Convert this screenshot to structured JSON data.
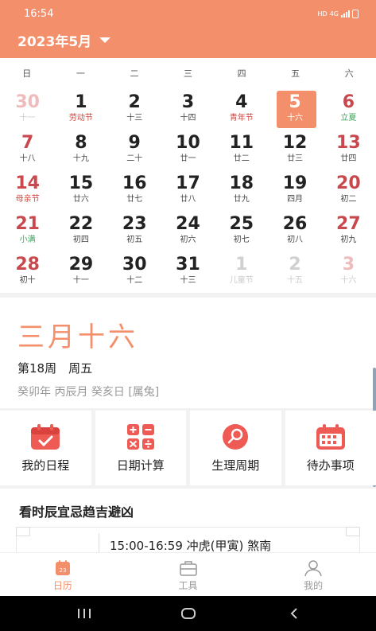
{
  "status": {
    "time": "16:54",
    "network": "HD",
    "signal": "4G"
  },
  "header": {
    "month_title": "2023年5月"
  },
  "weekdays": [
    "日",
    "一",
    "二",
    "三",
    "四",
    "五",
    "六"
  ],
  "days": [
    {
      "num": "30",
      "sub": "十一",
      "other": true,
      "red": true
    },
    {
      "num": "1",
      "sub": "劳动节",
      "hl": "red"
    },
    {
      "num": "2",
      "sub": "十三"
    },
    {
      "num": "3",
      "sub": "十四"
    },
    {
      "num": "4",
      "sub": "青年节",
      "hl": "red"
    },
    {
      "num": "5",
      "sub": "十六",
      "selected": true
    },
    {
      "num": "6",
      "sub": "立夏",
      "red": true,
      "hl": "green"
    },
    {
      "num": "7",
      "sub": "十八",
      "red": true
    },
    {
      "num": "8",
      "sub": "十九"
    },
    {
      "num": "9",
      "sub": "二十"
    },
    {
      "num": "10",
      "sub": "廿一"
    },
    {
      "num": "11",
      "sub": "廿二"
    },
    {
      "num": "12",
      "sub": "廿三"
    },
    {
      "num": "13",
      "sub": "廿四",
      "red": true
    },
    {
      "num": "14",
      "sub": "母亲节",
      "red": true,
      "hl": "red"
    },
    {
      "num": "15",
      "sub": "廿六"
    },
    {
      "num": "16",
      "sub": "廿七"
    },
    {
      "num": "17",
      "sub": "廿八"
    },
    {
      "num": "18",
      "sub": "廿九"
    },
    {
      "num": "19",
      "sub": "四月"
    },
    {
      "num": "20",
      "sub": "初二",
      "red": true
    },
    {
      "num": "21",
      "sub": "小满",
      "red": true,
      "hl": "green"
    },
    {
      "num": "22",
      "sub": "初四"
    },
    {
      "num": "23",
      "sub": "初五"
    },
    {
      "num": "24",
      "sub": "初六"
    },
    {
      "num": "25",
      "sub": "初七"
    },
    {
      "num": "26",
      "sub": "初八"
    },
    {
      "num": "27",
      "sub": "初九",
      "red": true
    },
    {
      "num": "28",
      "sub": "初十",
      "red": true
    },
    {
      "num": "29",
      "sub": "十一"
    },
    {
      "num": "30",
      "sub": "十二"
    },
    {
      "num": "31",
      "sub": "十三"
    },
    {
      "num": "1",
      "sub": "儿童节",
      "other": true
    },
    {
      "num": "2",
      "sub": "十五",
      "other": true
    },
    {
      "num": "3",
      "sub": "十六",
      "other": true,
      "red": true
    }
  ],
  "detail": {
    "lunar_date": "三月十六",
    "week_line": "第18周　周五",
    "ganzhi": "癸卯年 丙辰月 癸亥日 [属兔]"
  },
  "tools": [
    {
      "label": "我的日程",
      "icon": "calendar-check-icon"
    },
    {
      "label": "日期计算",
      "icon": "calculator-icon"
    },
    {
      "label": "生理周期",
      "icon": "cycle-search-icon"
    },
    {
      "label": "待办事项",
      "icon": "calendar-grid-icon"
    }
  ],
  "almanac": {
    "title": "看时辰宜忌趋吉避凶",
    "first_slot": "15:00-16:59  冲虎(甲寅) 煞南"
  },
  "tabs": [
    {
      "label": "日历",
      "icon": "calendar-tab-icon",
      "active": true,
      "badge": "23"
    },
    {
      "label": "工具",
      "icon": "toolbox-icon"
    },
    {
      "label": "我的",
      "icon": "user-icon"
    }
  ],
  "colors": {
    "accent": "#f48f6b",
    "holiday_red": "#c9484d",
    "solar_term_green": "#3aa35a"
  }
}
